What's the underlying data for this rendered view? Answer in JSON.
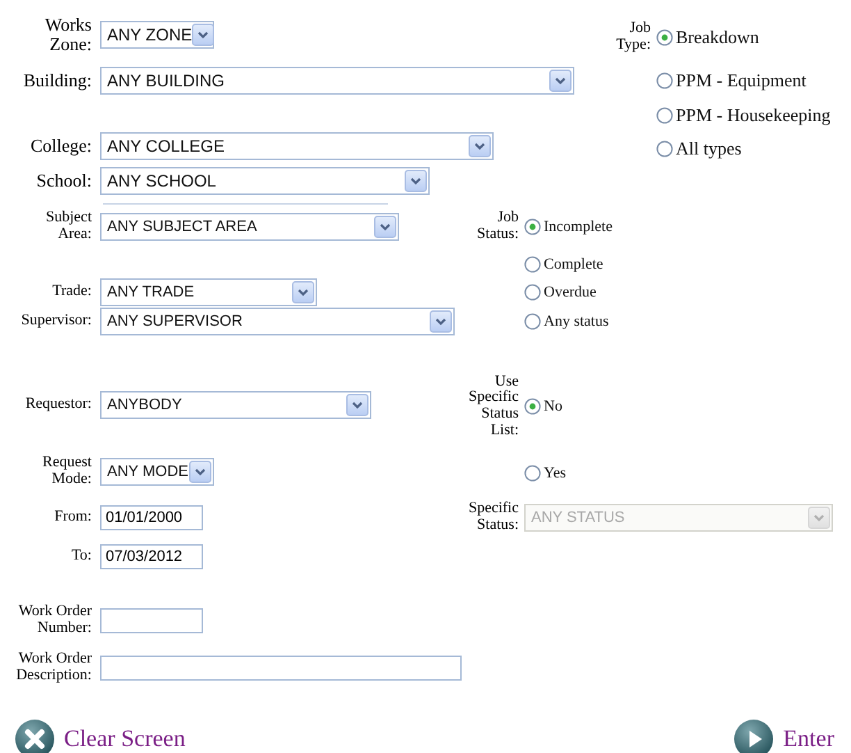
{
  "left_fields": [
    {
      "label": "Works\nZone:",
      "kind": "select",
      "value": "ANY ZONE"
    },
    {
      "label": "Building:",
      "kind": "select",
      "value": "ANY BUILDING"
    },
    {
      "label": "College:",
      "kind": "select",
      "value": "ANY COLLEGE"
    },
    {
      "label": "School:",
      "kind": "select",
      "value": "ANY SCHOOL"
    },
    {
      "label": "Subject\nArea:",
      "kind": "select",
      "value": "ANY SUBJECT AREA"
    },
    {
      "label": "Trade:",
      "kind": "select",
      "value": "ANY TRADE"
    },
    {
      "label": "Supervisor:",
      "kind": "select",
      "value": "ANY SUPERVISOR"
    },
    {
      "label": "Requestor:",
      "kind": "select",
      "value": "ANYBODY"
    },
    {
      "label": "Request\nMode:",
      "kind": "select",
      "value": "ANY MODE"
    },
    {
      "label": "From:",
      "kind": "text",
      "value": "01/01/2000"
    },
    {
      "label": "To:",
      "kind": "text",
      "value": "07/03/2012"
    },
    {
      "label": "Work Order\nNumber:",
      "kind": "text"
    },
    {
      "label": "Work Order\nDescription:",
      "kind": "text"
    }
  ],
  "job_type": {
    "label": "Job\nType:",
    "options": [
      {
        "label": "Breakdown",
        "selected": true
      },
      {
        "label": "PPM - Equipment",
        "selected": false
      },
      {
        "label": "PPM - Housekeeping",
        "selected": false
      },
      {
        "label": "All types",
        "selected": false
      }
    ]
  },
  "job_status": {
    "label": "Job\nStatus:",
    "options": [
      {
        "label": "Incomplete",
        "selected": true
      },
      {
        "label": "Complete",
        "selected": false
      },
      {
        "label": "Overdue",
        "selected": false
      },
      {
        "label": "Any status",
        "selected": false
      }
    ]
  },
  "use_specific_status_list": {
    "label": "Use\nSpecific\nStatus\nList:",
    "options": [
      {
        "label": "No",
        "selected": true
      },
      {
        "label": "Yes",
        "selected": false
      }
    ]
  },
  "specific_status": {
    "label": "Specific\nStatus:",
    "value": "ANY STATUS",
    "disabled": true
  },
  "actions": [
    {
      "kind": "clear",
      "label": "Clear Screen"
    },
    {
      "kind": "enter",
      "label": "Enter"
    }
  ]
}
